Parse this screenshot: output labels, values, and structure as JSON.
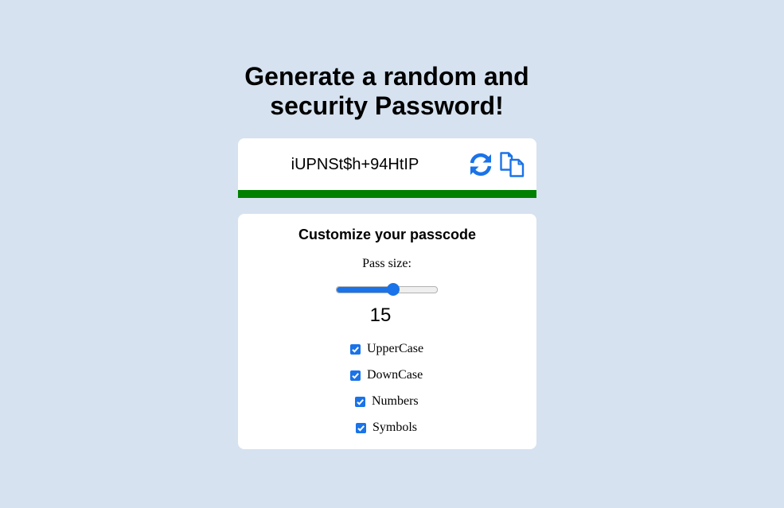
{
  "heading": {
    "line1": "Generate a random and",
    "line2": "security Password!"
  },
  "password": {
    "value": "iUPNSt$h+94HtIP",
    "strength_fraction": 1.0,
    "strength_color": "#008000"
  },
  "icons": {
    "refresh": "refresh-icon",
    "copy": "copy-icon"
  },
  "customize": {
    "title": "Customize your passcode",
    "size_label": "Pass size:",
    "size_value": "15",
    "slider_fraction": 0.56,
    "options": [
      {
        "label": "UpperCase",
        "checked": true
      },
      {
        "label": "DownCase",
        "checked": true
      },
      {
        "label": "Numbers",
        "checked": true
      },
      {
        "label": "Symbols",
        "checked": true
      }
    ]
  },
  "colors": {
    "background": "#d6e2f0",
    "accent": "#1a73e8",
    "card": "#ffffff"
  }
}
